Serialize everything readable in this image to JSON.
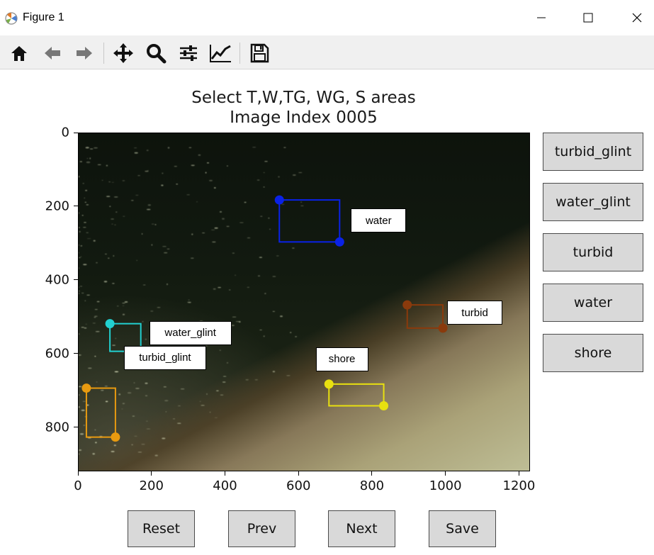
{
  "window": {
    "title": "Figure 1",
    "icon": "matplotlib-figure-icon",
    "controls": [
      "minimize-icon",
      "maximize-icon",
      "close-icon"
    ]
  },
  "toolbar": {
    "items": [
      "home-icon",
      "back-icon",
      "forward-icon",
      "pan-icon",
      "zoom-icon",
      "subplots-config-icon",
      "edit-axis-icon",
      "save-icon"
    ]
  },
  "figure": {
    "title_line1": "Select T,W,TG, WG, S areas",
    "title_line2": "Image Index 0005"
  },
  "axes": {
    "x_ticks": [
      "0",
      "200",
      "400",
      "600",
      "800",
      "1000",
      "1200"
    ],
    "y_ticks": [
      "0",
      "200",
      "400",
      "600",
      "800"
    ],
    "x_range": [
      0,
      1230
    ],
    "y_range": [
      920,
      0
    ]
  },
  "annotations": [
    {
      "label": "water",
      "color": "#0a22e6",
      "x1": 548,
      "y1": 183,
      "x2": 712,
      "y2": 297
    },
    {
      "label": "turbid",
      "color": "#8a3a0c",
      "x1": 896,
      "y1": 468,
      "x2": 993,
      "y2": 531
    },
    {
      "label": "water_glint",
      "color": "#22d0d0",
      "x1": 87,
      "y1": 519,
      "x2": 171,
      "y2": 594
    },
    {
      "label": "shore",
      "color": "#e8e010",
      "x1": 683,
      "y1": 683,
      "x2": 832,
      "y2": 742
    },
    {
      "label": "turbid_glint",
      "color": "#e89a10",
      "x1": 23,
      "y1": 694,
      "x2": 102,
      "y2": 827
    }
  ],
  "side_buttons": {
    "turbid_glint": "turbid_glint",
    "water_glint": "water_glint",
    "turbid": "turbid",
    "water": "water",
    "shore": "shore"
  },
  "bottom_buttons": {
    "reset": "Reset",
    "prev": "Prev",
    "next": "Next",
    "save": "Save"
  }
}
